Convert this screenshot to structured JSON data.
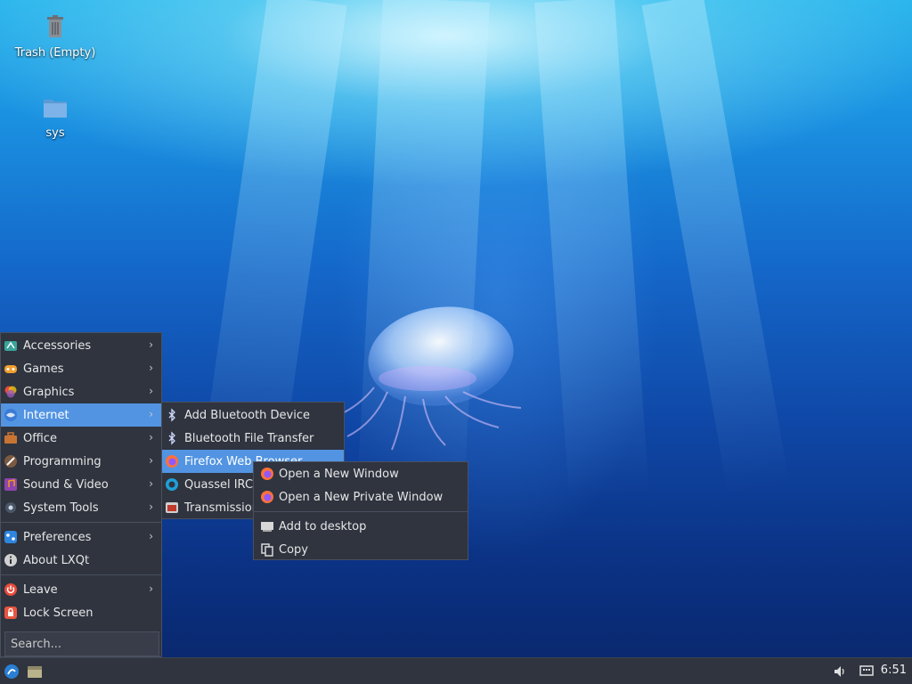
{
  "desktop": {
    "icons": [
      {
        "label": "Trash (Empty)",
        "icon": "trash-icon"
      },
      {
        "label": "sys",
        "icon": "folder-icon"
      }
    ]
  },
  "start_menu": {
    "items": [
      {
        "label": "Accessories",
        "icon": "accessories-icon",
        "submenu": true
      },
      {
        "label": "Games",
        "icon": "games-icon",
        "submenu": true
      },
      {
        "label": "Graphics",
        "icon": "graphics-icon",
        "submenu": true
      },
      {
        "label": "Internet",
        "icon": "internet-icon",
        "submenu": true,
        "active": true
      },
      {
        "label": "Office",
        "icon": "office-icon",
        "submenu": true
      },
      {
        "label": "Programming",
        "icon": "programming-icon",
        "submenu": true
      },
      {
        "label": "Sound & Video",
        "icon": "sound-video-icon",
        "submenu": true
      },
      {
        "label": "System Tools",
        "icon": "system-tools-icon",
        "submenu": true
      }
    ],
    "preferences": {
      "label": "Preferences",
      "icon": "preferences-icon"
    },
    "about": {
      "label": "About LXQt",
      "icon": "info-icon"
    },
    "leave": {
      "label": "Leave",
      "icon": "power-icon"
    },
    "lock": {
      "label": "Lock Screen",
      "icon": "lock-icon"
    },
    "search_placeholder": "Search..."
  },
  "internet_submenu": {
    "items": [
      {
        "label": "Add Bluetooth Device",
        "icon": "bluetooth-icon"
      },
      {
        "label": "Bluetooth File Transfer",
        "icon": "bluetooth-icon"
      },
      {
        "label": "Firefox Web Browser",
        "icon": "firefox-icon",
        "active": true
      },
      {
        "label": "Quassel IRC",
        "icon": "quassel-icon"
      },
      {
        "label": "Transmission",
        "icon": "transmission-icon"
      }
    ]
  },
  "context_menu": {
    "items": [
      {
        "label": "Open a New Window",
        "icon": "firefox-icon"
      },
      {
        "label": "Open a New Private Window",
        "icon": "firefox-icon"
      }
    ],
    "add_to_desktop": "Add to desktop",
    "copy": "Copy"
  },
  "taskbar": {
    "clock": "6:51"
  },
  "colors": {
    "menu_bg": "#2f343f",
    "highlight": "#5294e2",
    "taskbar_bg": "#2f343f"
  }
}
